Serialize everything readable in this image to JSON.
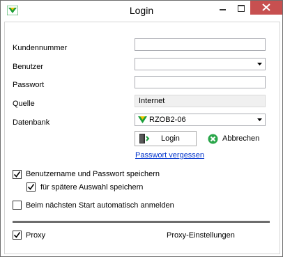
{
  "window": {
    "title": "Login"
  },
  "form": {
    "customer_number_label": "Kundennummer",
    "customer_number_value": "",
    "user_label": "Benutzer",
    "user_value": "",
    "password_label": "Passwort",
    "password_value": "",
    "source_label": "Quelle",
    "source_value": "Internet",
    "database_label": "Datenbank",
    "database_value": "RZOB2-06"
  },
  "actions": {
    "login_label": "Login",
    "cancel_label": "Abbrechen",
    "forgot_password_label": "Passwort vergessen"
  },
  "options": {
    "save_credentials_label": "Benutzername und Passwort speichern",
    "save_credentials_checked": true,
    "save_for_selection_label": "für spätere Auswahl speichern",
    "save_for_selection_checked": true,
    "auto_login_label": "Beim nächsten Start automatisch anmelden",
    "auto_login_checked": false
  },
  "proxy": {
    "proxy_label": "Proxy",
    "proxy_checked": true,
    "proxy_settings_label": "Proxy-Einstellungen"
  },
  "colors": {
    "close_button": "#c75050",
    "link": "#0033cc",
    "logo_green": "#1a9e3a"
  }
}
